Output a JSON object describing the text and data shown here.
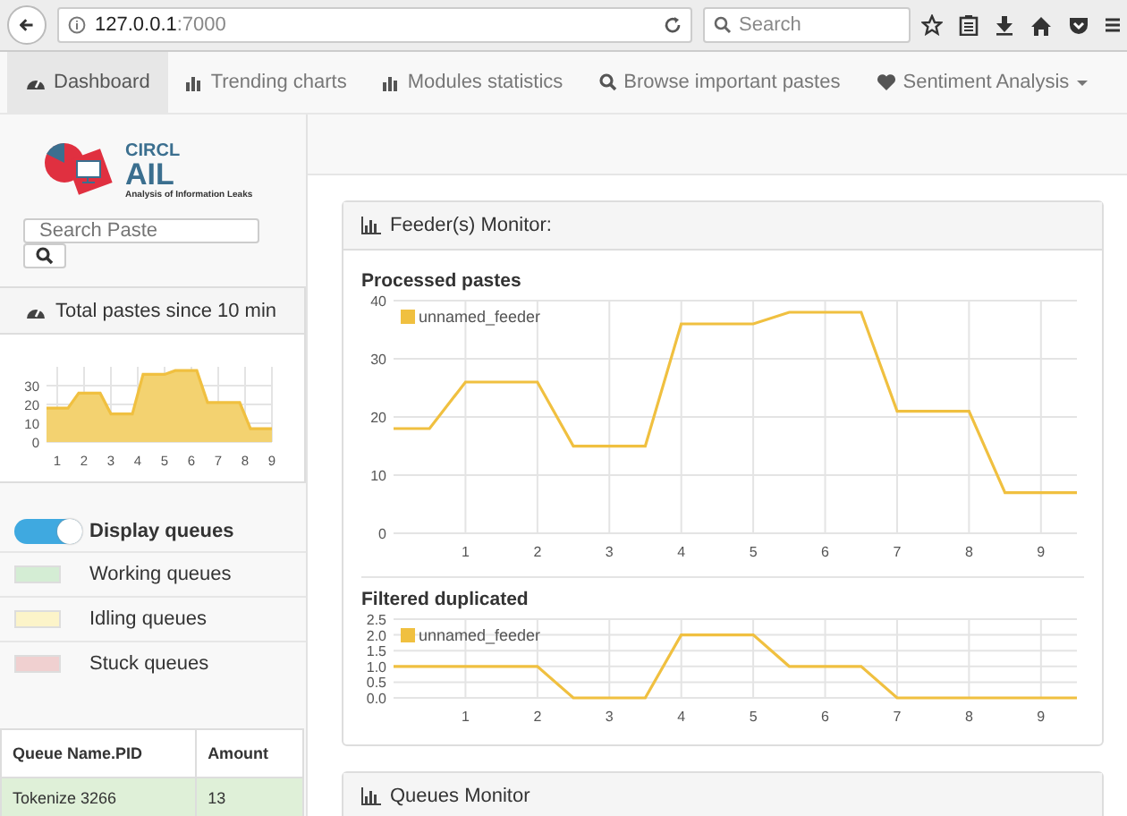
{
  "browser": {
    "url_host": "127.0.0.1",
    "url_port": ":7000",
    "search_placeholder": "Search"
  },
  "navbar": {
    "items": [
      {
        "label": "Dashboard",
        "selected": true
      },
      {
        "label": "Trending charts",
        "selected": false
      },
      {
        "label": "Modules statistics",
        "selected": false
      },
      {
        "label": "Browse important pastes",
        "selected": false
      },
      {
        "label": "Sentiment Analysis",
        "selected": false,
        "dropdown": true
      }
    ]
  },
  "sidebar": {
    "logo": {
      "title": "CIRCL",
      "name": "AIL",
      "subtitle": "Analysis of Information Leaks"
    },
    "search": {
      "placeholder": "Search Paste"
    },
    "total_panel": {
      "title": "Total pastes since 10 min",
      "chart_data": {
        "type": "area",
        "x": [
          0.6,
          1,
          1.4,
          1.8,
          2.2,
          2.6,
          3,
          3.4,
          3.8,
          4.2,
          4.6,
          5,
          5.4,
          5.8,
          6.2,
          6.6,
          7,
          7.4,
          7.8,
          8.2,
          8.6,
          9
        ],
        "series": [
          {
            "color": "#f0c040",
            "values": [
              18,
              18,
              18,
              26,
              26,
              26,
              15,
              15,
              15,
              36,
              36,
              36,
              38,
              38,
              38,
              21,
              21,
              21,
              21,
              7,
              7,
              7
            ]
          }
        ],
        "xticks": [
          1,
          2,
          3,
          4,
          5,
          6,
          7,
          8,
          9
        ],
        "yticks": [
          0,
          10,
          20,
          30
        ],
        "ylim": [
          0,
          40
        ],
        "xlim": [
          0.6,
          9
        ],
        "grid": true
      }
    },
    "display_queues": {
      "label": "Display queues",
      "on": true
    },
    "legend": [
      {
        "label": "Working queues",
        "color": "#d4edd4"
      },
      {
        "label": "Idling queues",
        "color": "#fcf4c9"
      },
      {
        "label": "Stuck queues",
        "color": "#f0d0d0"
      }
    ],
    "table": {
      "columns": [
        "Queue Name.PID",
        "Amount"
      ],
      "rows": [
        {
          "cells": [
            "Tokenize 3266",
            "13"
          ],
          "color": "#dff0d8"
        }
      ]
    }
  },
  "main": {
    "feeder_panel": {
      "title": "Feeder(s) Monitor:",
      "charts": [
        {
          "title": "Processed pastes",
          "chart_data": {
            "type": "line",
            "x": [
              0,
              0.5,
              1,
              1.5,
              2,
              2.5,
              3,
              3.5,
              4,
              4.5,
              5,
              5.5,
              6,
              6.5,
              7,
              7.5,
              8,
              8.5,
              9,
              9.5
            ],
            "series": [
              {
                "name": "unnamed_feeder",
                "color": "#f0c040",
                "values": [
                  18,
                  18,
                  26,
                  26,
                  26,
                  15,
                  15,
                  15,
                  36,
                  36,
                  36,
                  38,
                  38,
                  38,
                  21,
                  21,
                  21,
                  7,
                  7,
                  7
                ]
              }
            ],
            "xticks": [
              1,
              2,
              3,
              4,
              5,
              6,
              7,
              8,
              9
            ],
            "yticks": [
              0,
              10,
              20,
              30,
              40
            ],
            "ylim": [
              0,
              40
            ],
            "xlim": [
              0,
              9.5
            ],
            "grid": true
          }
        },
        {
          "title": "Filtered duplicated",
          "chart_data": {
            "type": "line",
            "x": [
              0,
              0.5,
              1,
              1.5,
              2,
              2.5,
              3,
              3.5,
              4,
              4.5,
              5,
              5.5,
              6,
              6.5,
              7,
              7.5,
              8,
              8.5,
              9,
              9.5
            ],
            "series": [
              {
                "name": "unnamed_feeder",
                "color": "#f0c040",
                "values": [
                  1,
                  1,
                  1,
                  1,
                  1,
                  0,
                  0,
                  0,
                  2,
                  2,
                  2,
                  1,
                  1,
                  1,
                  0,
                  0,
                  0,
                  0,
                  0,
                  0
                ]
              }
            ],
            "xticks": [
              1,
              2,
              3,
              4,
              5,
              6,
              7,
              8,
              9
            ],
            "yticks": [
              {
                "value": 0,
                "label": "0.0"
              },
              {
                "value": 0.5,
                "label": "0.5"
              },
              {
                "value": 1,
                "label": "1.0"
              },
              {
                "value": 1.5,
                "label": "1.5"
              },
              {
                "value": 2,
                "label": "2.0"
              },
              {
                "value": 2.5,
                "label": "2.5"
              }
            ],
            "ylim": [
              0,
              2.5
            ],
            "xlim": [
              0,
              9.5
            ],
            "grid": true
          }
        }
      ]
    },
    "queues_panel": {
      "title": "Queues Monitor"
    }
  }
}
